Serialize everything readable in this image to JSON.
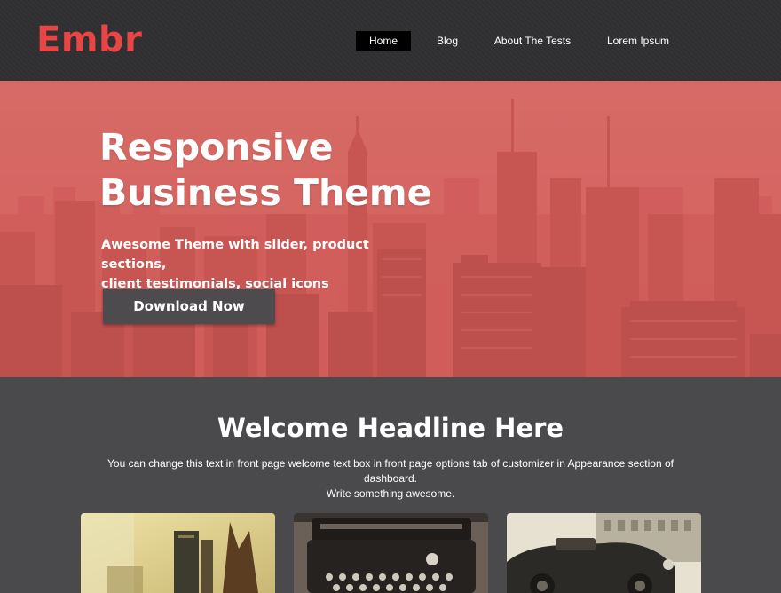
{
  "header": {
    "logo": "Embr",
    "nav": [
      {
        "label": "Home",
        "active": true
      },
      {
        "label": "Blog",
        "active": false
      },
      {
        "label": "About The Tests",
        "active": false
      },
      {
        "label": "Lorem Ipsum",
        "active": false
      }
    ]
  },
  "hero": {
    "title_line1": "Responsive",
    "title_line2": "Business Theme",
    "subtitle_line1": "Awesome Theme with slider, product sections,",
    "subtitle_line2": "client testimonials, social icons",
    "button_label": "Download Now",
    "overlay_color": "#e05f5c",
    "image": "city-skyline-photo"
  },
  "welcome": {
    "title": "Welcome Headline Here",
    "text_line1": "You can change this text in front page welcome text box in front page options tab of customizer in Appearance section of dashboard.",
    "text_line2": "Write something awesome."
  },
  "cards": [
    {
      "image": "desk-books-photo"
    },
    {
      "image": "typewriter-photo"
    },
    {
      "image": "vintage-car-photo"
    }
  ],
  "colors": {
    "accent": "#e94545",
    "header_bg": "#2f2f31",
    "body_bg": "#4a4a4c",
    "button_bg": "#4d4b4d"
  }
}
